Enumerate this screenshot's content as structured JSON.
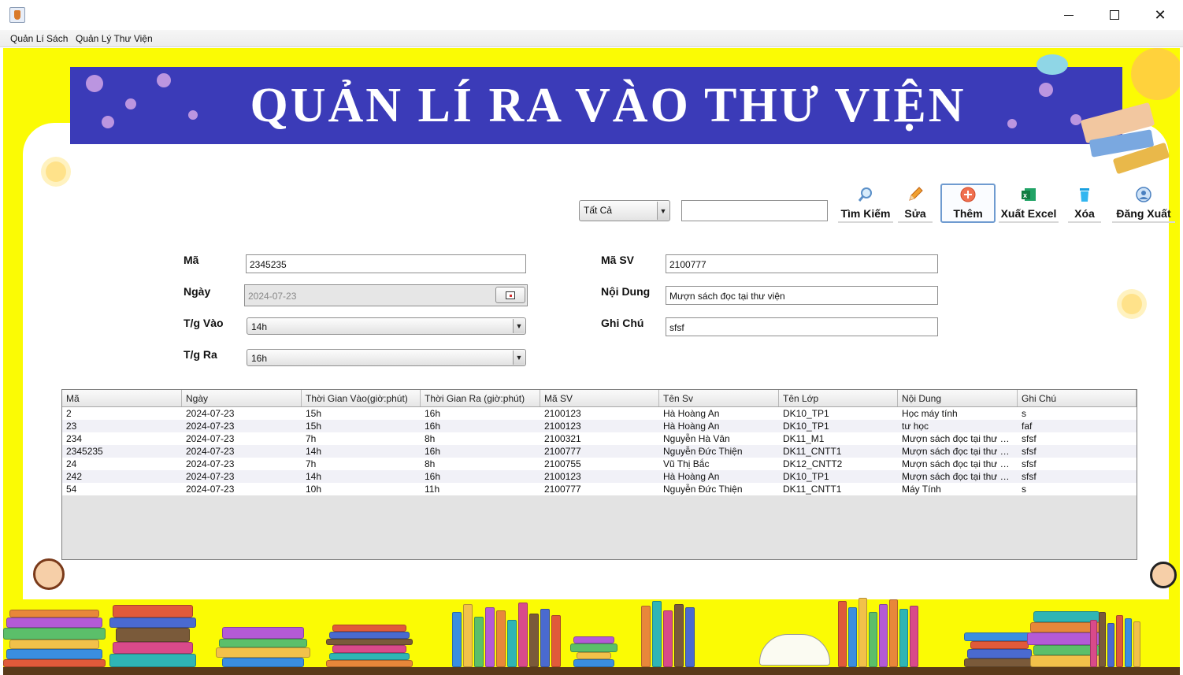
{
  "window": {
    "menu": [
      "Quản Lí Sách",
      "Quản Lý Thư Viện"
    ]
  },
  "banner": {
    "title": "QUẢN LÍ  RA VÀO THƯ VIỆN"
  },
  "toolbar": {
    "filter": "Tất Cả",
    "search_value": "",
    "buttons": [
      {
        "label": "Tìm Kiếm",
        "icon": "magnifier-icon"
      },
      {
        "label": "Sửa",
        "icon": "pencil-icon"
      },
      {
        "label": "Thêm",
        "icon": "plus-circle-icon"
      },
      {
        "label": "Xuất Excel",
        "icon": "excel-icon"
      },
      {
        "label": "Xóa",
        "icon": "trash-icon"
      },
      {
        "label": "Đăng Xuất",
        "icon": "user-icon"
      }
    ]
  },
  "form": {
    "ma_label": "Mã",
    "ma": "2345235",
    "ngay_label": "Ngày",
    "ngay": "2024-07-23",
    "tgvao_label": "T/g Vào",
    "tgvao": "14h",
    "tgra_label": "T/g Ra",
    "tgra": "16h",
    "masv_label": "Mã SV",
    "masv": "2100777",
    "noidung_label": "Nội Dung",
    "noidung": "Mượn sách đọc tại thư viện",
    "ghichu_label": "Ghi Chú",
    "ghichu": "sfsf"
  },
  "table": {
    "columns": [
      "Mã",
      "Ngày",
      "Thời Gian Vào(giờ:phút)",
      "Thời Gian Ra (giờ:phút)",
      "Mã SV",
      "Tên Sv",
      "Tên Lớp",
      "Nội Dung",
      "Ghi Chú"
    ],
    "rows": [
      [
        "2",
        "2024-07-23",
        "15h",
        "16h",
        "2100123",
        "Hà Hoàng An",
        "DK10_TP1",
        "Học máy tính",
        "s"
      ],
      [
        "23",
        "2024-07-23",
        "15h",
        "16h",
        "2100123",
        "Hà Hoàng An",
        "DK10_TP1",
        "tư học",
        "faf"
      ],
      [
        "234",
        "2024-07-23",
        "7h",
        "8h",
        "2100321",
        "Nguyễn Hà Vân",
        "DK11_M1",
        "Mượn sách đọc tại thư vi...",
        "sfsf"
      ],
      [
        "2345235",
        "2024-07-23",
        "14h",
        "16h",
        "2100777",
        "Nguyễn Đức Thiện",
        "DK11_CNTT1",
        "Mượn sách đọc tại thư vi...",
        "sfsf"
      ],
      [
        "24",
        "2024-07-23",
        "7h",
        "8h",
        "2100755",
        "Vũ Thị Bắc",
        "DK12_CNTT2",
        "Mượn sách đọc tại thư vi...",
        "sfsf"
      ],
      [
        "242",
        "2024-07-23",
        "14h",
        "16h",
        "2100123",
        "Hà Hoàng An",
        "DK10_TP1",
        "Mượn sách đọc tại thư vi...",
        "sfsf"
      ],
      [
        "54",
        "2024-07-23",
        "10h",
        "11h",
        "2100777",
        "Nguyễn Đức Thiện",
        "DK11_CNTT1",
        "Máy Tính",
        "s"
      ]
    ]
  },
  "colors": {
    "background": "#fbfb04",
    "banner": "#3b3bb8",
    "accent": "#6f9bd0"
  }
}
